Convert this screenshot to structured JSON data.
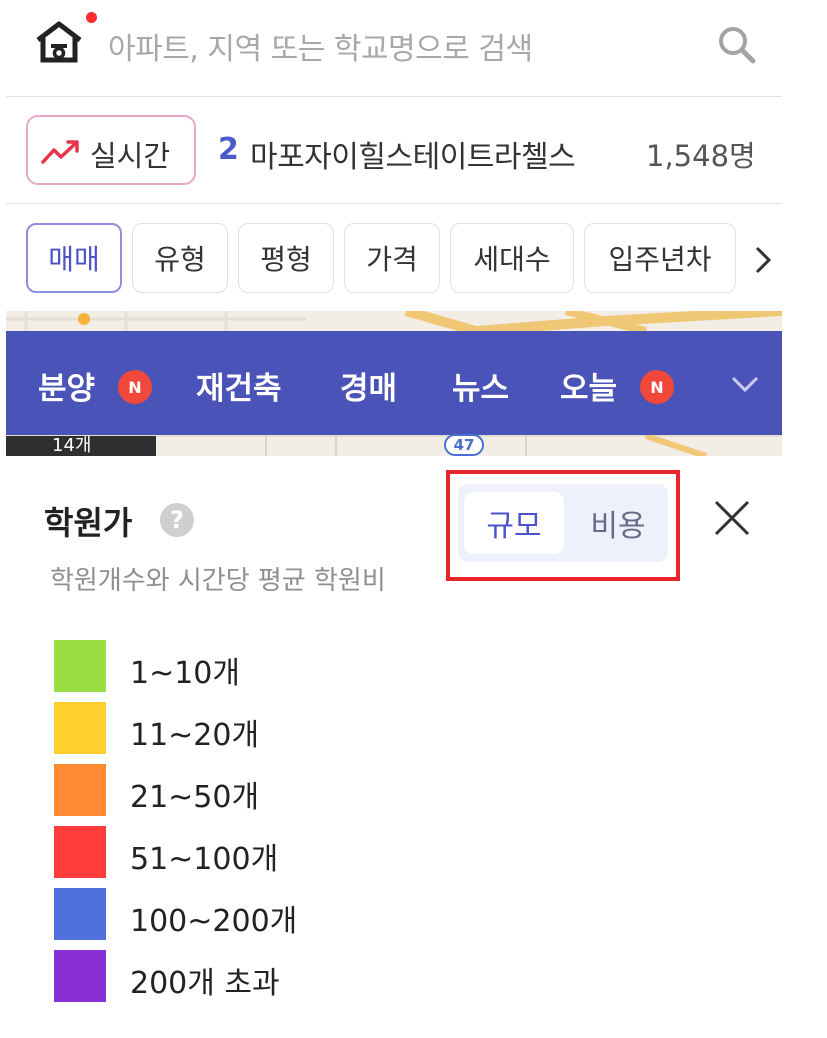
{
  "search": {
    "placeholder": "아파트, 지역 또는 학교명으로 검색"
  },
  "realtime": {
    "chip_label": "실시간",
    "rank": "2",
    "name": "마포자이힐스테이트라첼스",
    "count": "1,548명"
  },
  "filters": [
    {
      "label": "매매",
      "active": true
    },
    {
      "label": "유형",
      "active": false
    },
    {
      "label": "평형",
      "active": false
    },
    {
      "label": "가격",
      "active": false
    },
    {
      "label": "세대수",
      "active": false
    },
    {
      "label": "입주년차",
      "active": false
    }
  ],
  "nav": {
    "items": [
      {
        "label": "분양",
        "badge": "N"
      },
      {
        "label": "재건축"
      },
      {
        "label": "경매"
      },
      {
        "label": "뉴스"
      },
      {
        "label": "오늘",
        "badge": "N"
      }
    ]
  },
  "map": {
    "count_label": "14개",
    "road_label": "47"
  },
  "academy": {
    "title": "학원가",
    "help": "?",
    "description": "학원개수와 시간당 평균 학원비",
    "toggle": {
      "selected": "규모",
      "other": "비용"
    },
    "legend": [
      {
        "label": "1~10개",
        "color": "#99dd44"
      },
      {
        "label": "11~20개",
        "color": "#ffd12e"
      },
      {
        "label": "21~50개",
        "color": "#ff8a33"
      },
      {
        "label": "51~100개",
        "color": "#ff3b3b"
      },
      {
        "label": "100~200개",
        "color": "#4f6fdd"
      },
      {
        "label": "200개 초과",
        "color": "#8a2ed6"
      }
    ]
  },
  "colors": {
    "brand": "#4a53b8",
    "accent": "#4a53c9",
    "highlight_border": "#e8232a"
  }
}
